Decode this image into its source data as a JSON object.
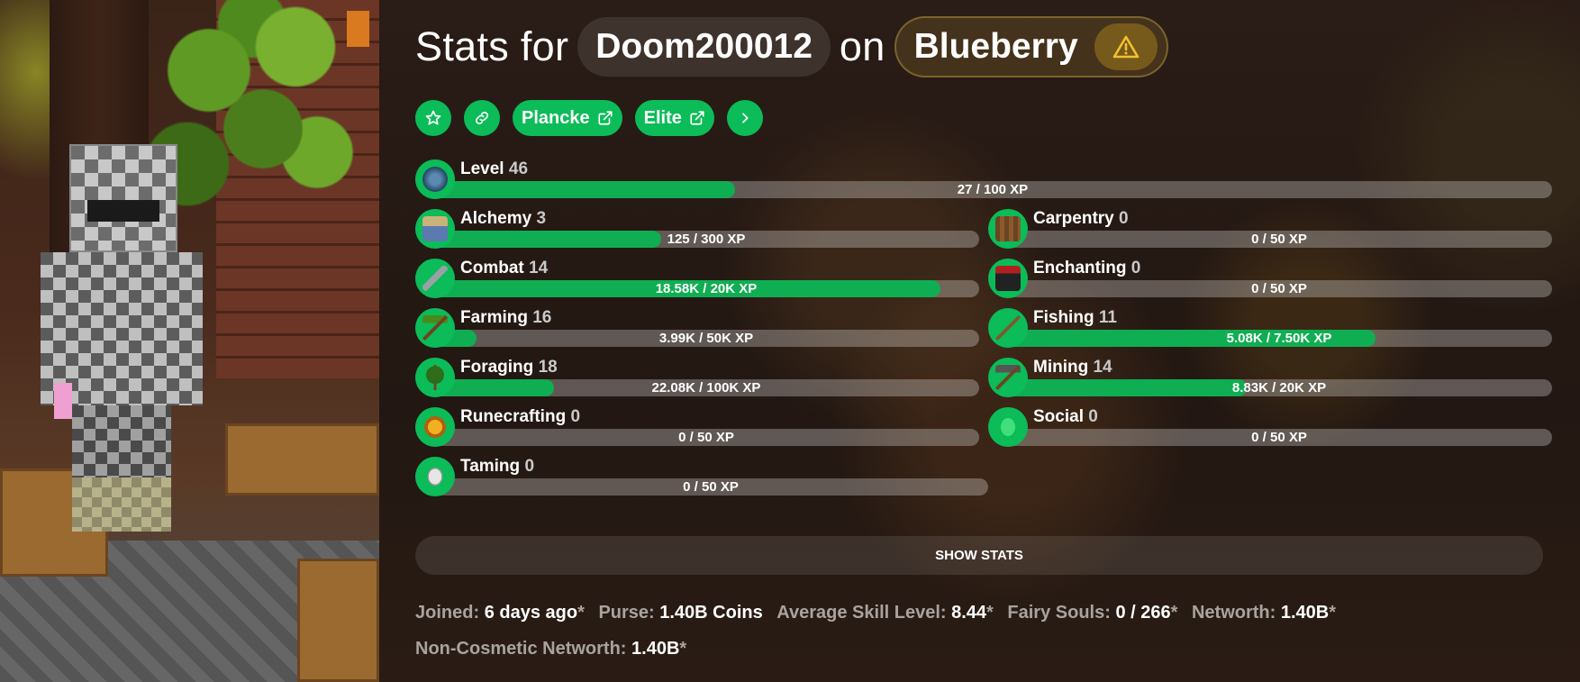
{
  "header": {
    "prefix": "Stats for",
    "player": "Doom200012",
    "on": "on",
    "profile": "Blueberry",
    "warning_icon": "warning-triangle-icon"
  },
  "actions": {
    "favorite_icon": "star-icon",
    "link_icon": "link-icon",
    "plancke_label": "Plancke",
    "elite_label": "Elite",
    "more_icon": "chevron-right-icon"
  },
  "skills": {
    "level": {
      "name": "Level",
      "level": "46",
      "xp": "27 / 100 XP",
      "progress": 0.27
    },
    "alchemy": {
      "name": "Alchemy",
      "level": "3",
      "xp": "125 / 300 XP",
      "progress": 0.417
    },
    "carpentry": {
      "name": "Carpentry",
      "level": "0",
      "xp": "0 / 50 XP",
      "progress": 0
    },
    "combat": {
      "name": "Combat",
      "level": "14",
      "xp": "18.58K / 20K XP",
      "progress": 0.929
    },
    "enchanting": {
      "name": "Enchanting",
      "level": "0",
      "xp": "0 / 50 XP",
      "progress": 0
    },
    "farming": {
      "name": "Farming",
      "level": "16",
      "xp": "3.99K / 50K XP",
      "progress": 0.08
    },
    "fishing": {
      "name": "Fishing",
      "level": "11",
      "xp": "5.08K / 7.50K XP",
      "progress": 0.677
    },
    "foraging": {
      "name": "Foraging",
      "level": "18",
      "xp": "22.08K / 100K XP",
      "progress": 0.221
    },
    "mining": {
      "name": "Mining",
      "level": "14",
      "xp": "8.83K / 20K XP",
      "progress": 0.441
    },
    "runecrafting": {
      "name": "Runecrafting",
      "level": "0",
      "xp": "0 / 50 XP",
      "progress": 0
    },
    "social": {
      "name": "Social",
      "level": "0",
      "xp": "0 / 50 XP",
      "progress": 0
    },
    "taming": {
      "name": "Taming",
      "level": "0",
      "xp": "0 / 50 XP",
      "progress": 0
    }
  },
  "show_stats_label": "SHOW STATS",
  "info": {
    "joined_label": "Joined:",
    "joined_value": "6 days ago",
    "joined_star": "*",
    "purse_label": "Purse:",
    "purse_value": "1.40B Coins",
    "avg_skill_label": "Average Skill Level:",
    "avg_skill_value": "8.44",
    "avg_skill_star": "*",
    "fairy_label": "Fairy Souls:",
    "fairy_value": "0 / 266",
    "fairy_star": "*",
    "networth_label": "Networth:",
    "networth_value": "1.40B",
    "networth_star": "*",
    "noncos_label": "Non-Cosmetic Networth:",
    "noncos_value": "1.40B",
    "noncos_star": "*"
  },
  "colors": {
    "accent": "#0bbc58",
    "bar_fill": "#0fae52",
    "warning": "#f2c12e"
  }
}
